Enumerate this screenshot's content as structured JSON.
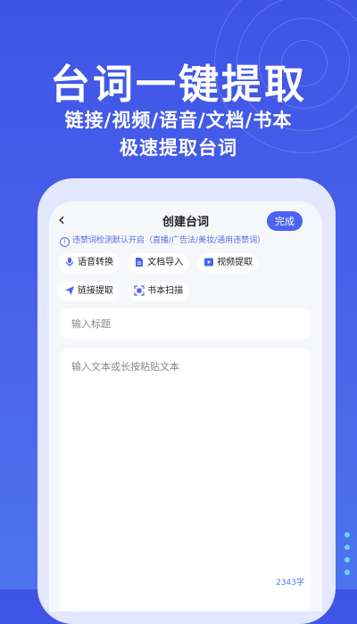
{
  "hero": {
    "title": "台词一键提取",
    "subtitle_line1": "链接/视频/语音/文档/书本",
    "subtitle_line2": "极速提取台词"
  },
  "nav": {
    "back_label": "‹",
    "title": "创建台词",
    "done_label": "完成"
  },
  "notice": {
    "text": "违禁词检测默认开启（直播/广告法/美妆/通用违禁词）"
  },
  "tools": [
    {
      "label": "语音转换",
      "icon": "microphone-icon"
    },
    {
      "label": "文档导入",
      "icon": "document-icon"
    },
    {
      "label": "视频提取",
      "icon": "video-icon"
    },
    {
      "label": "链接提取",
      "icon": "send-icon"
    },
    {
      "label": "书本扫描",
      "icon": "scan-icon"
    }
  ],
  "form": {
    "title_placeholder": "输入标题",
    "body_placeholder": "输入文本或长按粘贴文本",
    "char_count": "2343字"
  },
  "colors": {
    "background": "#4258e8",
    "accent": "#4b63f0",
    "dots": "#6ad3f4"
  }
}
